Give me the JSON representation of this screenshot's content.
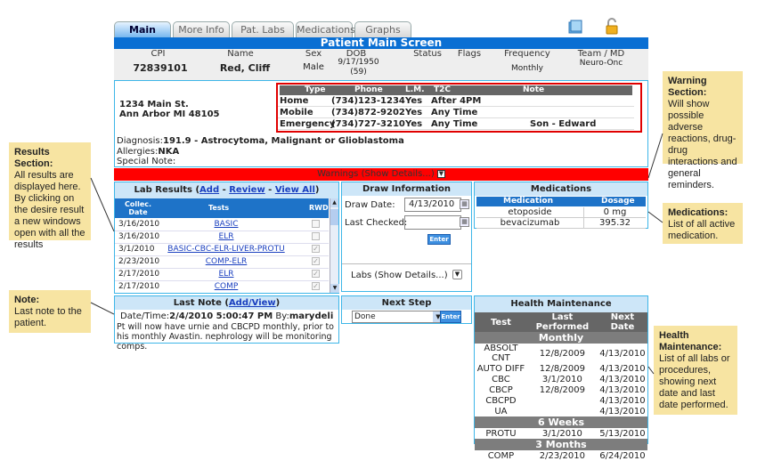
{
  "tabs": [
    {
      "label": "Main"
    },
    {
      "label": "More Info"
    },
    {
      "label": "Pat. Labs"
    },
    {
      "label": "Medications"
    },
    {
      "label": "Graphs"
    }
  ],
  "screen_title": "Patient Main Screen",
  "patient_header": {
    "cpi_label": "CPI",
    "cpi": "72839101",
    "name_label": "Name",
    "name": "Red, Cliff",
    "sex_label": "Sex",
    "sex": "Male",
    "dob_label": "DOB",
    "dob": "9/17/1950",
    "age": "(59)",
    "status_label": "Status",
    "flags_label": "Flags",
    "frequency_label": "Frequency",
    "frequency": "Monthly",
    "team_label": "Team / MD",
    "team": "Neuro-Onc"
  },
  "address": {
    "line1": "1234 Main St.",
    "line2": "Ann Arbor MI 48105"
  },
  "contacts": {
    "headers": [
      "Type",
      "Phone",
      "L.M.",
      "T2C",
      "Note"
    ],
    "rows": [
      {
        "type": "Home",
        "phone": "(734)123-1234",
        "lm": "Yes",
        "t2c": "After 4PM",
        "note": ""
      },
      {
        "type": "Mobile",
        "phone": "(734)872-9202",
        "lm": "Yes",
        "t2c": "Any Time",
        "note": ""
      },
      {
        "type": "Emergency",
        "phone": "(734)727-3210",
        "lm": "Yes",
        "t2c": "Any Time",
        "note": "Son - Edward"
      }
    ]
  },
  "diagnosis": {
    "label": "Diagnosis:",
    "value": "191.9 - Astrocytoma, Malignant or Glioblastoma"
  },
  "allergies": {
    "label": "Allergies:",
    "value": "NKA"
  },
  "special_note": {
    "label": "Special Note:"
  },
  "warnings_label": "Warnings (Show Details...)",
  "lab_results": {
    "title": "Lab Results",
    "add": "Add",
    "review": "Review",
    "view_all": "View All",
    "col_date": "Collec. Date",
    "col_tests": "Tests",
    "col_rwd": "RWD",
    "rows": [
      {
        "date": "3/16/2010",
        "test": "BASIC",
        "checked": false
      },
      {
        "date": "3/16/2010",
        "test": "ELR",
        "checked": false
      },
      {
        "date": "3/1/2010",
        "test": "BASIC-CBC-ELR-LIVER-PROTU",
        "checked": true
      },
      {
        "date": "2/23/2010",
        "test": "COMP-ELR",
        "checked": true
      },
      {
        "date": "2/17/2010",
        "test": "ELR",
        "checked": true
      },
      {
        "date": "2/17/2010",
        "test": "COMP",
        "checked": true
      }
    ]
  },
  "draw_info": {
    "title": "Draw Information",
    "draw_date_label": "Draw Date:",
    "draw_date": "4/13/2010",
    "last_checked_label": "Last Checked:",
    "last_checked": "",
    "enter": "Enter",
    "labs_details": "Labs (Show Details...)"
  },
  "medications": {
    "title": "Medications",
    "col_med": "Medication",
    "col_dose": "Dosage",
    "rows": [
      {
        "name": "etoposide",
        "dose": "0 mg"
      },
      {
        "name": "bevacizumab",
        "dose": "395.32"
      }
    ]
  },
  "last_note": {
    "title": "Last Note",
    "add_view": "Add/View",
    "datetime_label": "Date/Time:",
    "datetime": "2/4/2010 5:00:47 PM",
    "by_label": "By:",
    "by": "marydeli",
    "text": "Pt will now have urnie and CBCPD monthly, prior to his monthly Avastin. nephrology will be monitoring comps."
  },
  "next_step": {
    "title": "Next Step",
    "value": "Done",
    "enter": "Enter"
  },
  "health_maintenance": {
    "title": "Health Maintenance",
    "col_test": "Test",
    "col_last": "Last Performed",
    "col_next": "Next Date",
    "sections": [
      {
        "name": "Monthly",
        "rows": [
          {
            "test": "ABSOLT CNT",
            "last": "12/8/2009",
            "next": "4/13/2010"
          },
          {
            "test": "AUTO DIFF",
            "last": "12/8/2009",
            "next": "4/13/2010"
          },
          {
            "test": "CBC",
            "last": "3/1/2010",
            "next": "4/13/2010"
          },
          {
            "test": "CBCP",
            "last": "12/8/2009",
            "next": "4/13/2010"
          },
          {
            "test": "CBCPD",
            "last": "",
            "next": "4/13/2010"
          },
          {
            "test": "UA",
            "last": "",
            "next": "4/13/2010"
          }
        ]
      },
      {
        "name": "6 Weeks",
        "rows": [
          {
            "test": "PROTU",
            "last": "3/1/2010",
            "next": "5/13/2010"
          }
        ]
      },
      {
        "name": "3 Months",
        "rows": [
          {
            "test": "COMP",
            "last": "2/23/2010",
            "next": "6/24/2010"
          }
        ]
      }
    ]
  },
  "callouts": {
    "results": {
      "title": "Results Section:",
      "text": "All results are displayed here. By clicking on the desire result a new windows open with all the results"
    },
    "note": {
      "title": "Note:",
      "text": "Last note to the patient."
    },
    "warning": {
      "title": "Warning Section:",
      "text": "Will show possible adverse reactions, drug-drug interactions and general reminders."
    },
    "medications": {
      "title": "Medications:",
      "text": "List of all active medication."
    },
    "health": {
      "title": "Health Maintenance:",
      "text": "List of all labs or procedures, showing next date and last date performed."
    }
  },
  "colors": {
    "accent_blue": "#0a6fd3",
    "panel_border": "#3db6e8",
    "warning_red": "#ff0000",
    "callout_bg": "#f7e4a2"
  }
}
